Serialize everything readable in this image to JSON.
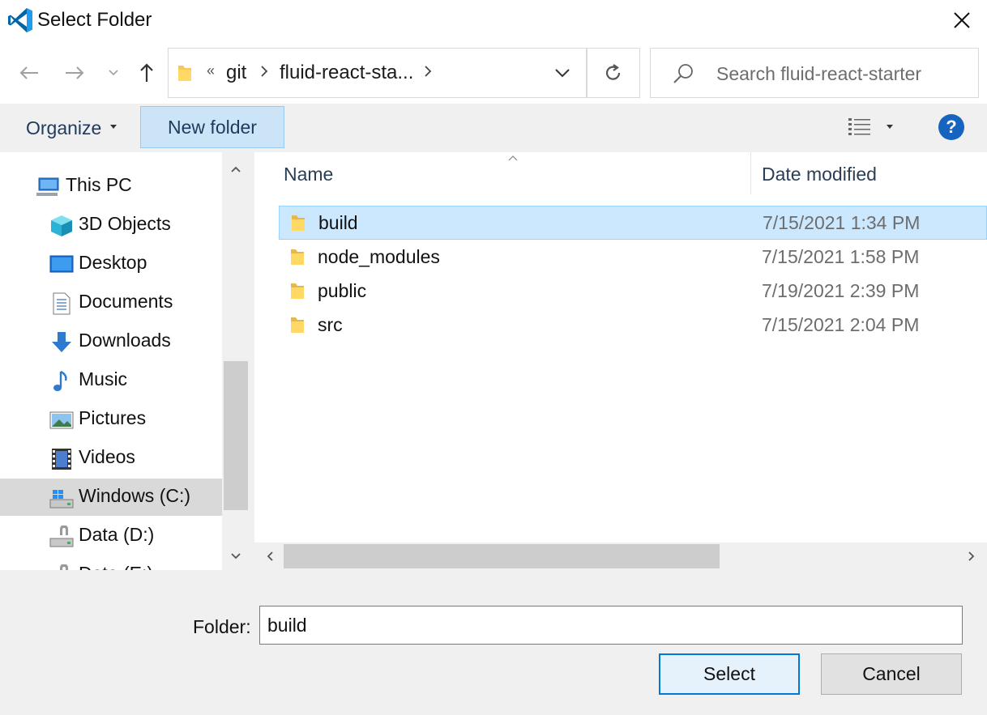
{
  "window": {
    "title": "Select Folder",
    "app_icon": "vscode-logo-icon",
    "close_icon": "close-icon"
  },
  "navigation": {
    "back_icon": "arrow-left-icon",
    "forward_icon": "arrow-right-icon",
    "recent_icon": "chevron-down-icon",
    "up_icon": "arrow-up-icon"
  },
  "address": {
    "overflow_marker": "«",
    "breadcrumbs": [
      "git",
      "fluid-react-sta..."
    ],
    "refresh_icon": "refresh-icon"
  },
  "search": {
    "placeholder": "Search fluid-react-starter"
  },
  "toolbar": {
    "organize_label": "Organize",
    "new_folder_label": "New folder",
    "view_icon": "details-view-icon",
    "help_label": "?"
  },
  "sidebar": {
    "items": [
      {
        "label": "This PC",
        "icon": "computer-icon"
      },
      {
        "label": "3D Objects",
        "icon": "cube-icon"
      },
      {
        "label": "Desktop",
        "icon": "desktop-icon"
      },
      {
        "label": "Documents",
        "icon": "document-icon"
      },
      {
        "label": "Downloads",
        "icon": "download-icon"
      },
      {
        "label": "Music",
        "icon": "music-note-icon"
      },
      {
        "label": "Pictures",
        "icon": "picture-icon"
      },
      {
        "label": "Videos",
        "icon": "film-icon"
      },
      {
        "label": "Windows (C:)",
        "icon": "system-drive-icon",
        "selected": true
      },
      {
        "label": "Data (D:)",
        "icon": "drive-icon"
      },
      {
        "label": "Data (E:)",
        "icon": "drive-icon"
      }
    ]
  },
  "filelist": {
    "columns": {
      "name": "Name",
      "date": "Date modified"
    },
    "rows": [
      {
        "name": "build",
        "date": "7/15/2021 1:34 PM",
        "selected": true
      },
      {
        "name": "node_modules",
        "date": "7/15/2021 1:58 PM"
      },
      {
        "name": "public",
        "date": "7/19/2021 2:39 PM"
      },
      {
        "name": "src",
        "date": "7/15/2021 2:04 PM"
      }
    ]
  },
  "footer": {
    "folder_label": "Folder:",
    "folder_value": "build",
    "select_label": "Select",
    "cancel_label": "Cancel"
  },
  "colors": {
    "accent": "#0078d7",
    "selection": "#cce8ff",
    "vscode_blue": "#23a9f2",
    "folder_yellow": "#f6c860"
  }
}
